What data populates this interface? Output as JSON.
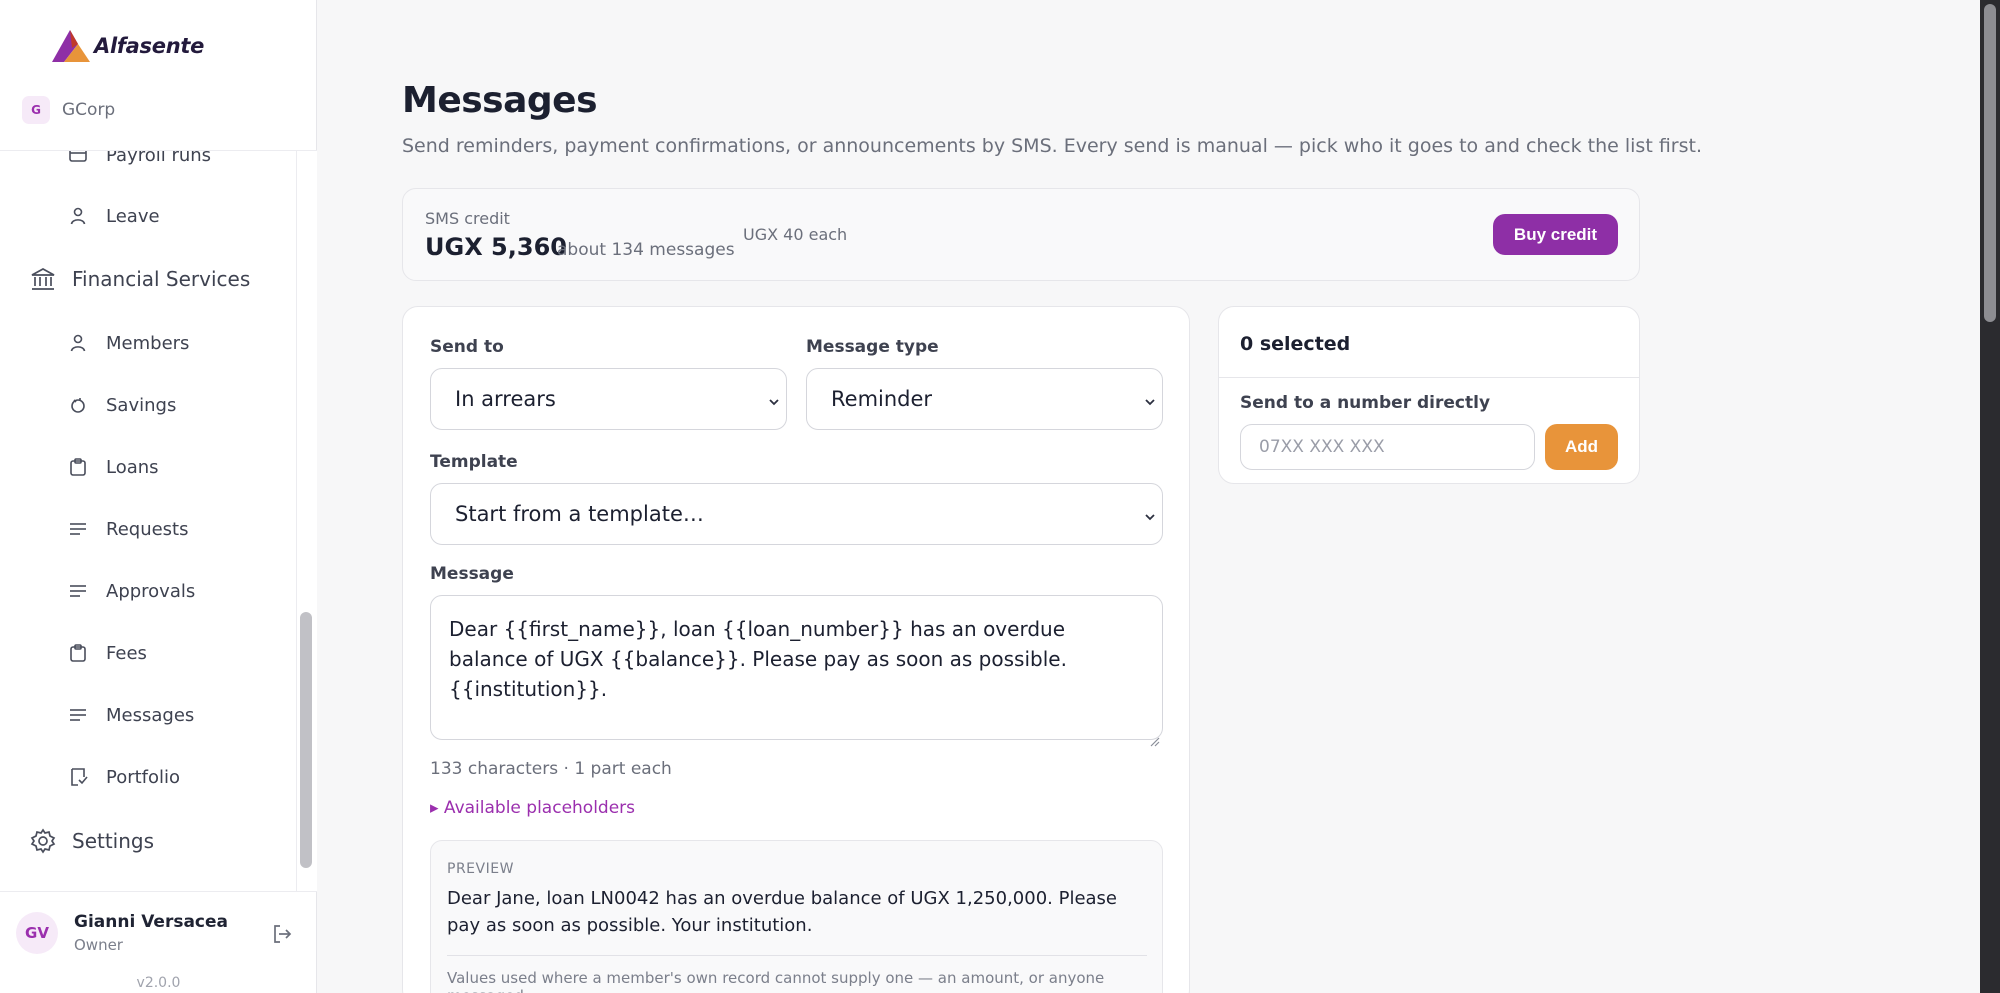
{
  "brand": {
    "name": "Alfasente"
  },
  "org": {
    "initial": "G",
    "name": "GCorp"
  },
  "nav": {
    "payroll_runs": "Payroll runs",
    "leave": "Leave",
    "financial_services": "Financial Services",
    "members": "Members",
    "savings": "Savings",
    "loans": "Loans",
    "requests": "Requests",
    "approvals": "Approvals",
    "fees": "Fees",
    "messages": "Messages",
    "portfolio": "Portfolio",
    "settings": "Settings"
  },
  "user": {
    "initials": "GV",
    "name": "Gianni Versacea",
    "role": "Owner"
  },
  "version": "v2.0.0",
  "page": {
    "title": "Messages",
    "subtitle": "Send reminders, payment confirmations, or announcements by SMS. Every send is manual — pick who it goes to and check the list first."
  },
  "credit": {
    "label": "SMS credit",
    "amount": "UGX 5,360",
    "approx": "about 134 messages",
    "rate": "UGX 40 each",
    "buy_label": "Buy credit"
  },
  "form": {
    "send_to_label": "Send to",
    "send_to_value": "In arrears",
    "type_label": "Message type",
    "type_value": "Reminder",
    "template_label": "Template",
    "template_value": "Start from a template…",
    "message_label": "Message",
    "message_value": "Dear {{first_name}}, loan {{loan_number}} has an overdue balance of UGX {{balance}}. Please pay as soon as possible. {{institution}}.",
    "char_count": "133 characters · 1 part each",
    "placeholders_link": "▸ Available placeholders"
  },
  "preview": {
    "label": "PREVIEW",
    "text": "Dear Jane, loan LN0042 has an overdue balance of UGX 1,250,000. Please pay as soon as possible. Your institution.",
    "note": "Values used where a member's own record cannot supply one — an amount, or anyone messaged"
  },
  "recipients": {
    "selected": "0 selected",
    "direct_label": "Send to a number directly",
    "phone_placeholder": "07XX XXX XXX",
    "add_label": "Add"
  }
}
